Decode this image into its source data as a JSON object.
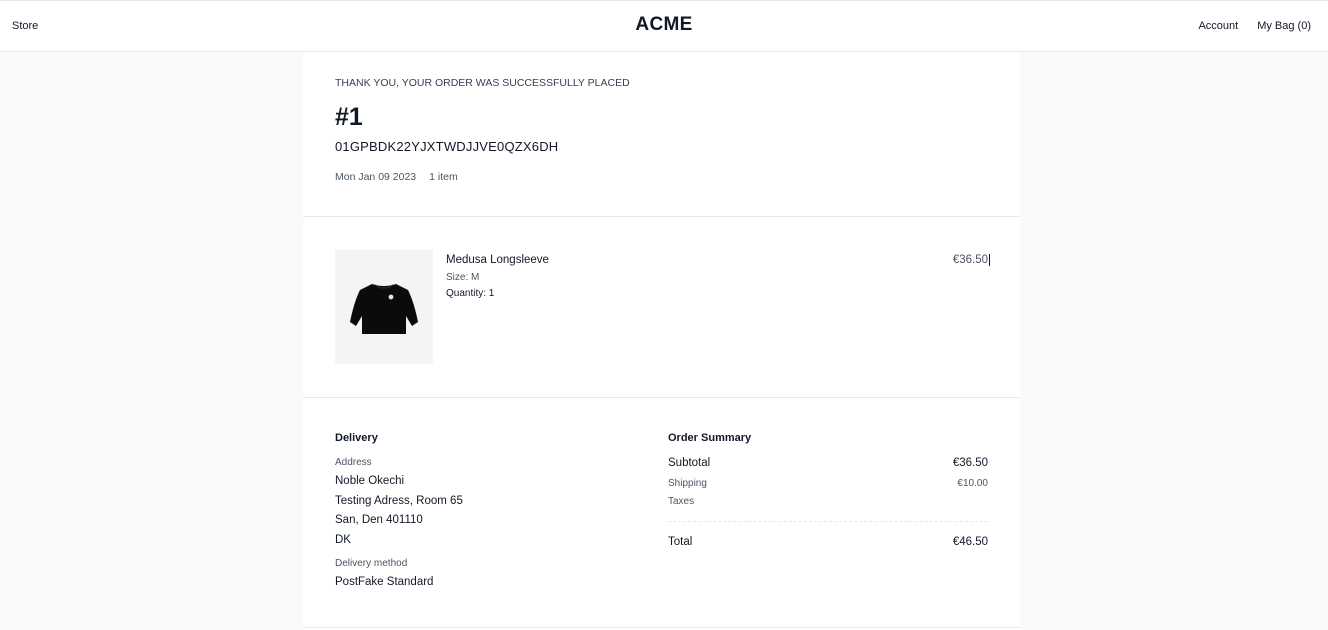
{
  "nav": {
    "store": "Store",
    "brand": "ACME",
    "account": "Account",
    "bag": "My Bag (0)"
  },
  "order": {
    "thank_you": "THANK YOU, YOUR ORDER WAS SUCCESSFULLY PLACED",
    "number": "#1",
    "id": "01GPBDK22YJXTWDJJVE0QZX6DH",
    "date": "Mon Jan 09 2023",
    "item_count": "1 item"
  },
  "item": {
    "title": "Medusa Longsleeve",
    "size": "Size: M",
    "quantity": "Quantity: 1",
    "price": "€36.50",
    "image_icon": "sweatshirt-icon"
  },
  "delivery": {
    "heading": "Delivery",
    "address_label": "Address",
    "address_lines": [
      "Noble Okechi",
      "Testing Adress, Room 65",
      "San, Den 401110",
      "DK"
    ],
    "method_label": "Delivery method",
    "method": "PostFake Standard"
  },
  "summary": {
    "heading": "Order Summary",
    "subtotal_label": "Subtotal",
    "subtotal": "€36.50",
    "shipping_label": "Shipping",
    "shipping": "€10.00",
    "taxes_label": "Taxes",
    "total_label": "Total",
    "total": "€46.50"
  }
}
